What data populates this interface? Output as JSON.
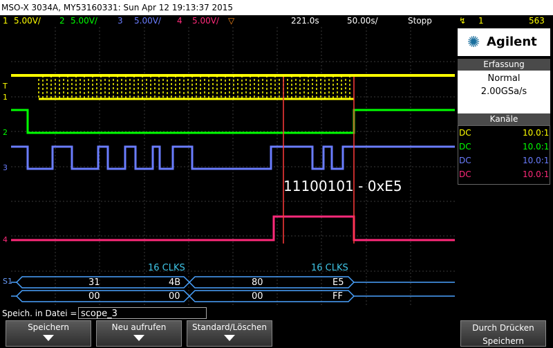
{
  "title": "MSO-X 3034A, MY53160331: Sun Apr 12 19:13:37 2015",
  "status": {
    "ch1": {
      "num": "1",
      "scale": "5.00V/",
      "color": "#ffff00"
    },
    "ch2": {
      "num": "2",
      "scale": "5.00V/",
      "color": "#00ff00"
    },
    "ch3": {
      "num": "3",
      "scale": "5.00V/",
      "color": "#6a7dff"
    },
    "ch4": {
      "num": "4",
      "scale": "5.00V/",
      "color": "#ff2a7a"
    },
    "timebase": "221.0s",
    "timescale": "50.00s/",
    "run_state": "Stopp",
    "trigger_icon": "trigger-edge-icon",
    "trigger_source": "1",
    "trigger_level": "563"
  },
  "brand": {
    "logo_icon": "agilent-spark-icon",
    "name": "Agilent"
  },
  "acquisition": {
    "title": "Erfassung",
    "mode": "Normal",
    "rate": "2.00GSa/s"
  },
  "channels_panel": {
    "title": "Kanäle",
    "rows": [
      {
        "coupling": "DC",
        "probe": "10.0:1",
        "color": "#ffff00"
      },
      {
        "coupling": "DC",
        "probe": "10.0:1",
        "color": "#00ff00"
      },
      {
        "coupling": "DC",
        "probe": "10.0:1",
        "color": "#6a7dff"
      },
      {
        "coupling": "DC",
        "probe": "10.0:1",
        "color": "#ff2a7a"
      }
    ]
  },
  "screen": {
    "annotation": "11100101 - 0xE5",
    "markers": {
      "t": "T",
      "ch1": "1",
      "ch2": "2",
      "ch3": "3",
      "ch4": "4",
      "s1": "S1"
    },
    "serial": {
      "clks_left": "16 CLKS",
      "clks_right": "16 CLKS",
      "row1": [
        "31",
        "4B",
        "80",
        "E5"
      ],
      "row2": [
        "00",
        "00",
        "00",
        "FF"
      ]
    }
  },
  "save": {
    "label": "Speich. in Datei =",
    "filename": "scope_3"
  },
  "softkeys": [
    "Speichern",
    "Neu aufrufen",
    "Standard/Löschen",
    "Durch Drücken Speichern"
  ]
}
